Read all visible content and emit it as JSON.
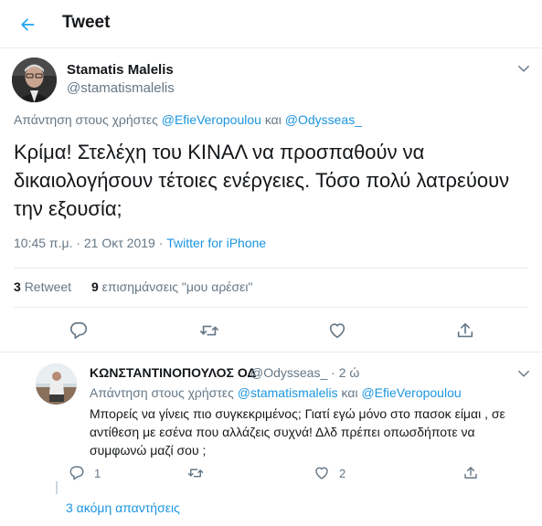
{
  "header": {
    "title": "Tweet",
    "back_icon": "arrow-left-icon",
    "accent": "#1da1f2"
  },
  "main_tweet": {
    "author_name": "Stamatis Malelis",
    "author_handle": "@stamatismalelis",
    "reply_prefix": "Απάντηση στους χρήστες",
    "reply_mention_1": "@EfieVeropoulou",
    "reply_connector": "και",
    "reply_mention_2": "@Odysseas_",
    "text": "Κρίμα! Στελέχη του ΚΙΝΑΛ να προσπαθούν να δικαιολογήσουν τέτοιες ενέργειες. Τόσο πολύ λατρεύουν την εξουσία;",
    "time": "10:45 π.μ.",
    "separator": "·",
    "date": "21 Οκτ 2019",
    "source": "Twitter for iPhone",
    "retweet_count": "3",
    "retweet_label": "Retweet",
    "like_count": "9",
    "like_label": "επισημάνσεις \"μου αρέσει\""
  },
  "reply_tweet": {
    "author_name": "ΚΩΝΣΤΑΝΤΙΝΟΠΟΥΛΟΣ ΟΔ",
    "author_handle": "@Odysseas_",
    "separator": "·",
    "time_ago": "2 ώ",
    "reply_prefix": "Απάντηση στους χρήστες",
    "reply_mention_1": "@stamatismalelis",
    "reply_connector": "και",
    "reply_mention_2": "@EfieVeropoulou",
    "text": "Μπορείς να γίνεις πιο συγκεκριμένος; Γιατί εγώ μόνο στο πασοκ είμαι , σε αντίθεση με εσένα που αλλάζεις συχνά! Δλδ πρέπει οπωσδήποτε να συμφωνώ μαζί σου ;",
    "reply_count": "1",
    "like_count": "2"
  },
  "more_replies_label": "3 ακόμη απαντήσεις",
  "colors": {
    "text_primary": "#14171a",
    "text_secondary": "#657786",
    "link": "#1b95e0",
    "border": "#e6ecf0"
  }
}
